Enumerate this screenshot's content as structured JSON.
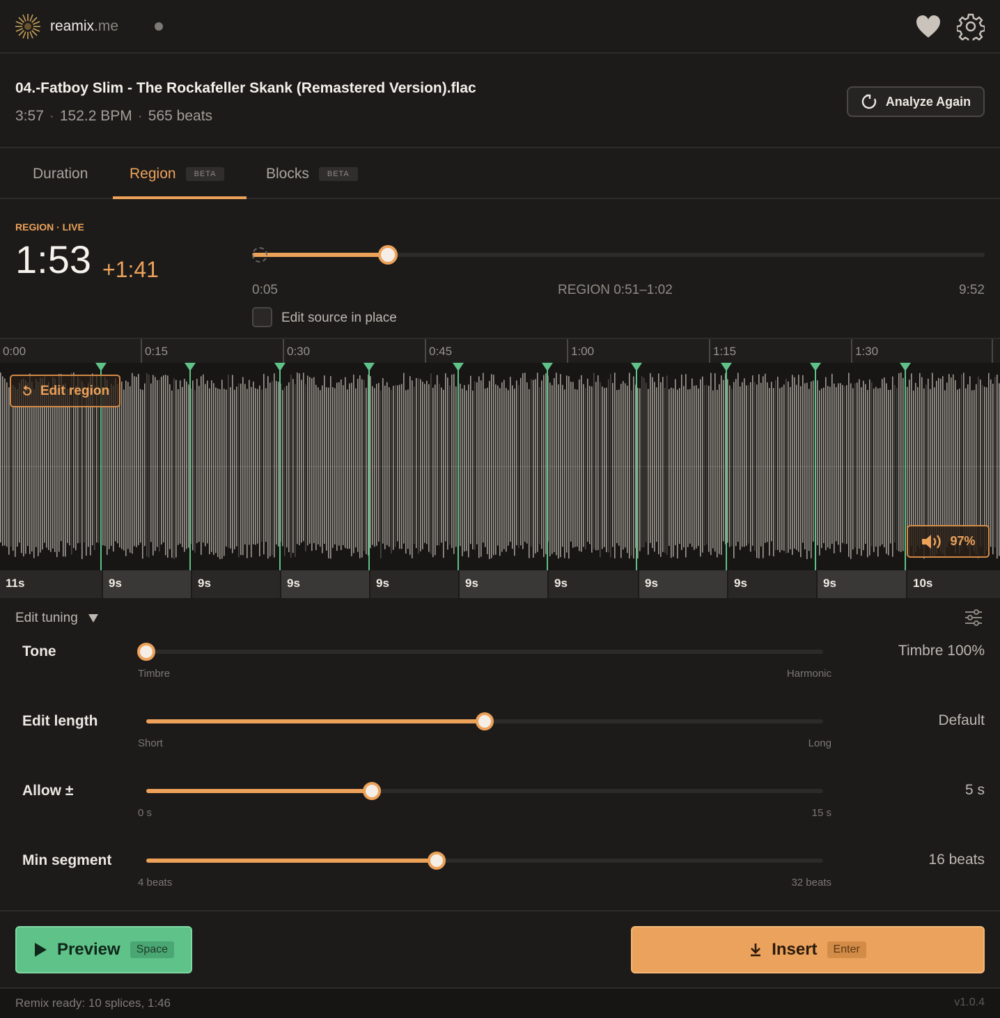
{
  "app": {
    "brand_name": "reamix",
    "brand_tld": ".me",
    "accent": "#eda25a",
    "success": "#5fc288"
  },
  "file": {
    "title": "04.-Fatboy Slim - The Rockafeller Skank (Remastered Version).flac",
    "duration": "3:57",
    "bpm": "152.2 BPM",
    "beats": "565 beats",
    "analyze_label": "Analyze Again"
  },
  "tabs": [
    {
      "label": "Duration",
      "badge": ""
    },
    {
      "label": "Region",
      "badge": "BETA"
    },
    {
      "label": "Blocks",
      "badge": "BETA"
    }
  ],
  "region": {
    "label": "REGION · LIVE",
    "time": "1:53",
    "delta": "+1:41",
    "range_min": "0:05",
    "range_label": "REGION 0:51–1:02",
    "range_max": "9:52",
    "fill_fraction": 0.185,
    "edit_in_place_label": "Edit source in place"
  },
  "timeline": {
    "ticks": [
      "0:00",
      "0:15",
      "0:30",
      "0:45",
      "1:00",
      "1:15",
      "1:30"
    ]
  },
  "waveform": {
    "edit_region_label": "Edit region",
    "volume_label": "97%",
    "colors": {
      "bar": "#a09a92",
      "dark": "#4a4744",
      "splice": "#5fc288"
    }
  },
  "segments": [
    "11s",
    "9s",
    "9s",
    "9s",
    "9s",
    "9s",
    "9s",
    "9s",
    "9s",
    "9s",
    "10s"
  ],
  "tuning": {
    "header": "Edit tuning",
    "rows": [
      {
        "label": "Tone",
        "min": "Timbre",
        "max": "Harmonic",
        "value": "Timbre 100%",
        "fraction": 0.0
      },
      {
        "label": "Edit length",
        "min": "Short",
        "max": "Long",
        "value": "Default",
        "fraction": 0.5
      },
      {
        "label": "Allow ±",
        "min": "0 s",
        "max": "15 s",
        "value": "5 s",
        "fraction": 0.333
      },
      {
        "label": "Min segment",
        "min": "4 beats",
        "max": "32 beats",
        "value": "16 beats",
        "fraction": 0.429
      }
    ]
  },
  "actions": {
    "preview_label": "Preview",
    "preview_key": "Space",
    "insert_label": "Insert",
    "insert_key": "Enter"
  },
  "status": {
    "message": "Remix ready: 10 splices, 1:46",
    "version": "v1.0.4"
  }
}
